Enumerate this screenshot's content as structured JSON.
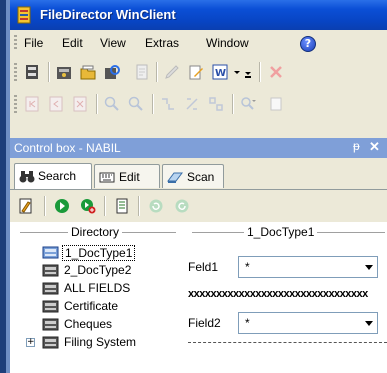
{
  "window": {
    "title": "FileDirector WinClient"
  },
  "menu": {
    "items": [
      {
        "label": "File",
        "id": "file"
      },
      {
        "label": "Edit",
        "id": "edit"
      },
      {
        "label": "View",
        "id": "view"
      },
      {
        "label": "Extras",
        "id": "extras"
      },
      {
        "label": "Window",
        "id": "window"
      }
    ],
    "help_icon": "help-icon",
    "help_glyph": "?"
  },
  "panel": {
    "title": "Control box - NABIL",
    "pin_glyph": "ᵽ",
    "close_glyph": "✕",
    "tabs": [
      {
        "label": "Search",
        "icon": "binoculars-icon",
        "active": true
      },
      {
        "label": "Edit",
        "icon": "keyboard-icon",
        "active": false
      },
      {
        "label": "Scan",
        "icon": "scanner-icon",
        "active": false
      }
    ]
  },
  "directory": {
    "header": "Directory",
    "items": [
      {
        "label": "1_DocType1",
        "selected": true
      },
      {
        "label": "2_DocType2",
        "selected": false
      },
      {
        "label": "ALL FIELDS",
        "selected": false
      },
      {
        "label": "Certificate",
        "selected": false
      },
      {
        "label": "Cheques",
        "selected": false
      },
      {
        "label": "Filing System",
        "selected": false,
        "expander": "+"
      }
    ]
  },
  "form": {
    "header": "1_DocType1",
    "fields": [
      {
        "label": "Feld1",
        "value": "*"
      },
      {
        "label": "Field2",
        "value": "*"
      }
    ],
    "separator_text": "xxxxxxxxxxxxxxxxxxxxxxxxxxxxxxxx"
  },
  "colors": {
    "titlebar": "#0845c4",
    "panel_header": "#7f9fd8",
    "chrome": "#ece9d8"
  }
}
